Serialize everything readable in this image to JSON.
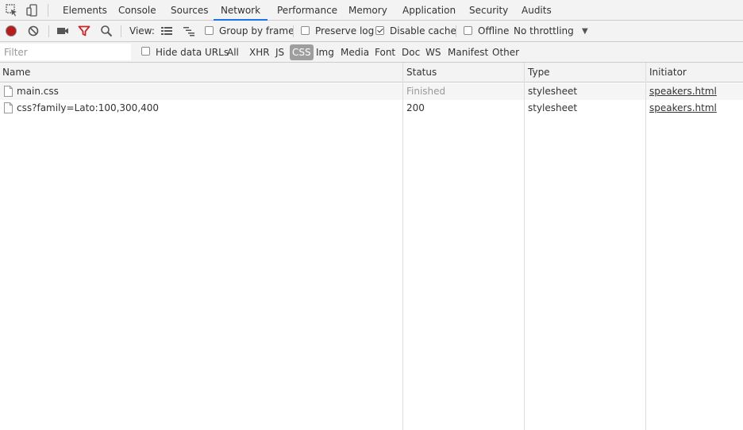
{
  "tabs": [
    {
      "label": "Elements",
      "active": false
    },
    {
      "label": "Console",
      "active": false
    },
    {
      "label": "Sources",
      "active": false
    },
    {
      "label": "Network",
      "active": true
    },
    {
      "label": "Performance",
      "active": false
    },
    {
      "label": "Memory",
      "active": false
    },
    {
      "label": "Application",
      "active": false
    },
    {
      "label": "Security",
      "active": false
    },
    {
      "label": "Audits",
      "active": false
    }
  ],
  "toolbar": {
    "view_label": "View:",
    "group_by_frame": {
      "label": "Group by frame",
      "checked": false
    },
    "preserve_log": {
      "label": "Preserve log",
      "checked": false
    },
    "disable_cache": {
      "label": "Disable cache",
      "checked": true
    },
    "offline": {
      "label": "Offline",
      "checked": false
    },
    "throttling": "No throttling",
    "record_color": "#b71c1c"
  },
  "filterbar": {
    "filter_placeholder": "Filter",
    "hide_data_urls": {
      "label": "Hide data URLs",
      "checked": false
    },
    "types": [
      {
        "label": "All",
        "active": false
      },
      {
        "label": "XHR",
        "active": false
      },
      {
        "label": "JS",
        "active": false
      },
      {
        "label": "CSS",
        "active": true
      },
      {
        "label": "Img",
        "active": false
      },
      {
        "label": "Media",
        "active": false
      },
      {
        "label": "Font",
        "active": false
      },
      {
        "label": "Doc",
        "active": false
      },
      {
        "label": "WS",
        "active": false
      },
      {
        "label": "Manifest",
        "active": false
      },
      {
        "label": "Other",
        "active": false
      }
    ]
  },
  "table": {
    "columns": [
      "Name",
      "Status",
      "Type",
      "Initiator"
    ],
    "rows": [
      {
        "name": "main.css",
        "status": "Finished",
        "type": "stylesheet",
        "initiator": "speakers.html"
      },
      {
        "name": "css?family=Lato:100,300,400",
        "status": "200",
        "type": "stylesheet",
        "initiator": "speakers.html"
      }
    ]
  },
  "colors": {
    "accent": "#1a73e8",
    "filter_red": "#c62828",
    "active_filter_bg": "#9e9e9e"
  }
}
